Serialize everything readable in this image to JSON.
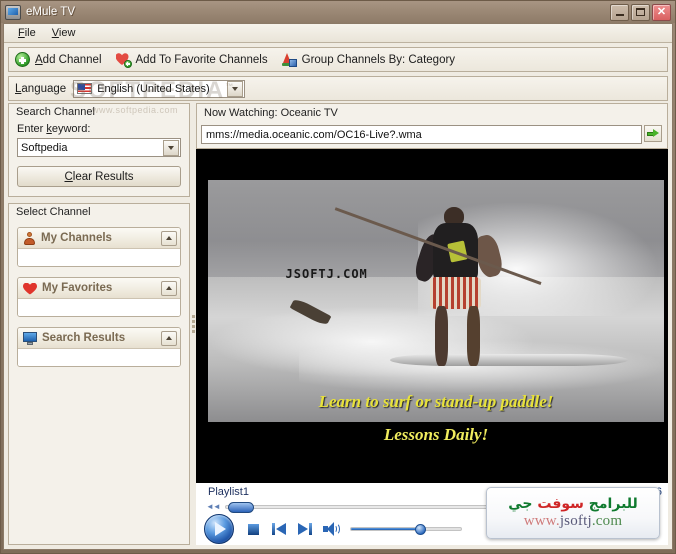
{
  "window": {
    "title": "eMule TV",
    "icon": "tv-icon",
    "buttons": {
      "minimize": "minimize-button",
      "maximize": "maximize-button",
      "close": "close-button",
      "close_glyph": "✕"
    }
  },
  "menubar": {
    "items": [
      {
        "label": "File",
        "accel": "F"
      },
      {
        "label": "View",
        "accel": "V"
      }
    ]
  },
  "toolbar": {
    "add_channel": "Add Channel",
    "add_to_favorites": "Add To Favorite Channels",
    "group_by": "Group Channels By: Category"
  },
  "language_bar": {
    "label": "Language",
    "selected": "English (United States)",
    "flag": "us-flag-icon"
  },
  "search_panel": {
    "group_title": "Search Channel",
    "keyword_label": "Enter keyword:",
    "keyword_value": "Softpedia",
    "keyword_placeholder": "",
    "clear_button": "Clear Results"
  },
  "select_panel": {
    "group_title": "Select Channel",
    "cards": [
      {
        "title": "My Channels",
        "icon": "person-icon",
        "expander": "collapse-chevron-icon",
        "items": []
      },
      {
        "title": "My Favorites",
        "icon": "heart-icon",
        "expander": "collapse-chevron-icon",
        "items": []
      },
      {
        "title": "Search Results",
        "icon": "monitor-icon",
        "expander": "collapse-chevron-icon",
        "items": []
      }
    ]
  },
  "viewer": {
    "now_watching": "Now Watching: Oceanic TV",
    "url": "mms://media.oceanic.com/OC16-Live?.wma",
    "go_button": "go-arrow-icon"
  },
  "video": {
    "watermark": "JSOFTJ.COM",
    "caption_line1": "Learn to surf or stand-up paddle!",
    "caption_line2": "Lessons Daily!"
  },
  "player": {
    "playlist_label": "Playlist1",
    "time": "00:16",
    "rewind_icon": "rewind-icon",
    "forward_icon": "fast-forward-icon",
    "play_icon": "play-icon",
    "stop_icon": "stop-icon",
    "previous_icon": "previous-track-icon",
    "next_icon": "next-track-icon",
    "volume_icon": "speaker-icon",
    "volume_percent": 58,
    "seek_percent": 2
  },
  "overlay": {
    "arabic_part1": "جي",
    "arabic_part2": "سوفت",
    "arabic_part3": "للبرامج",
    "site_www": "www.",
    "site_name": "jsoftj",
    "site_tld": ".com"
  },
  "watermark": {
    "brand": "SOFTPEDIA",
    "tm": "™",
    "url": "www.softpedia.com"
  },
  "colors": {
    "frame": "#8b7864",
    "client": "#efebe2",
    "accent_blue": "#1f55a8",
    "green": "#49b32a",
    "red": "#e0352c",
    "caption_yellow": "#e8e23a"
  }
}
